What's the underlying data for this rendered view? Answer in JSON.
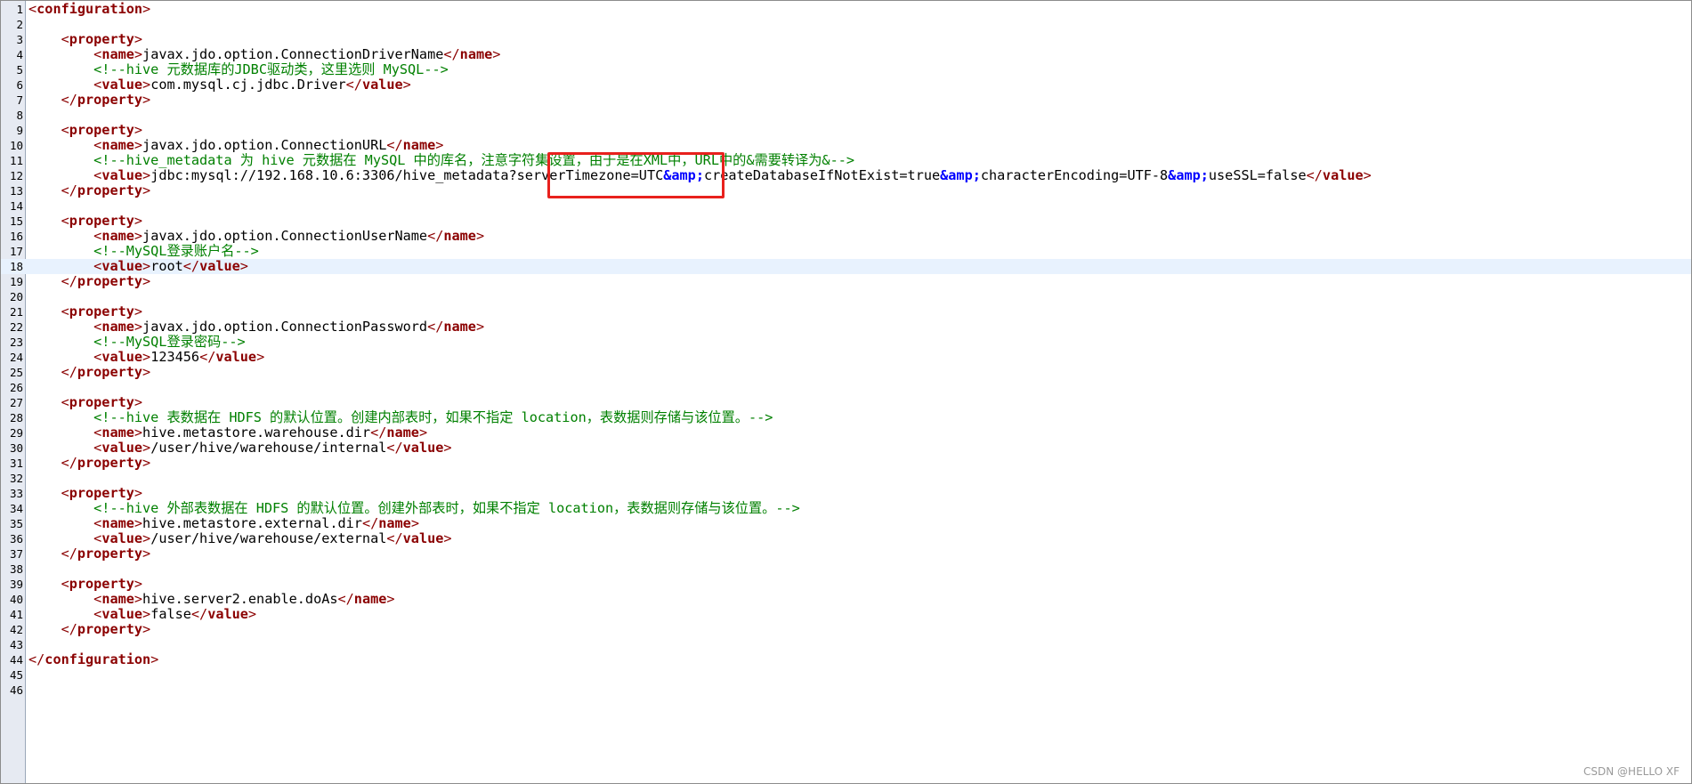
{
  "editor": {
    "current_line": 18,
    "lines": [
      {
        "n": "1",
        "t": [
          [
            "br",
            "<"
          ],
          [
            "tag",
            "configuration"
          ],
          [
            "br",
            ">"
          ]
        ]
      },
      {
        "n": "2",
        "t": []
      },
      {
        "n": "3",
        "t": [
          [
            "txt",
            "    "
          ],
          [
            "br",
            "<"
          ],
          [
            "tag",
            "property"
          ],
          [
            "br",
            ">"
          ]
        ]
      },
      {
        "n": "4",
        "t": [
          [
            "txt",
            "        "
          ],
          [
            "br",
            "<"
          ],
          [
            "tag",
            "name"
          ],
          [
            "br",
            ">"
          ],
          [
            "txt",
            "javax.jdo.option.ConnectionDriverName"
          ],
          [
            "br",
            "</"
          ],
          [
            "tag",
            "name"
          ],
          [
            "br",
            ">"
          ]
        ]
      },
      {
        "n": "5",
        "t": [
          [
            "txt",
            "        "
          ],
          [
            "com",
            "<!--hive 元数据库的JDBC驱动类，这里选则 MySQL-->"
          ]
        ]
      },
      {
        "n": "6",
        "t": [
          [
            "txt",
            "        "
          ],
          [
            "br",
            "<"
          ],
          [
            "tag",
            "value"
          ],
          [
            "br",
            ">"
          ],
          [
            "txt",
            "com.mysql.cj.jdbc.Driver"
          ],
          [
            "br",
            "</"
          ],
          [
            "tag",
            "value"
          ],
          [
            "br",
            ">"
          ]
        ]
      },
      {
        "n": "7",
        "t": [
          [
            "txt",
            "    "
          ],
          [
            "br",
            "</"
          ],
          [
            "tag",
            "property"
          ],
          [
            "br",
            ">"
          ]
        ]
      },
      {
        "n": "8",
        "t": []
      },
      {
        "n": "9",
        "t": [
          [
            "txt",
            "    "
          ],
          [
            "br",
            "<"
          ],
          [
            "tag",
            "property"
          ],
          [
            "br",
            ">"
          ]
        ]
      },
      {
        "n": "10",
        "t": [
          [
            "txt",
            "        "
          ],
          [
            "br",
            "<"
          ],
          [
            "tag",
            "name"
          ],
          [
            "br",
            ">"
          ],
          [
            "txt",
            "javax.jdo.option.ConnectionURL"
          ],
          [
            "br",
            "</"
          ],
          [
            "tag",
            "name"
          ],
          [
            "br",
            ">"
          ]
        ]
      },
      {
        "n": "11",
        "t": [
          [
            "txt",
            "        "
          ],
          [
            "com",
            "<!--hive_metadata 为 hive 元数据在 MySQL 中的库名，注意字符集设置，由于是在XML中，URL中的&需要转译为&-->"
          ]
        ]
      },
      {
        "n": "12",
        "t": [
          [
            "txt",
            "        "
          ],
          [
            "br",
            "<"
          ],
          [
            "tag",
            "value"
          ],
          [
            "br",
            ">"
          ],
          [
            "txt",
            "jdbc:mysql://192.168.10.6:3306/hive_metadata?serverTimezone=UTC"
          ],
          [
            "ent",
            "&amp;"
          ],
          [
            "txt",
            "createDatabaseIfNotExist=true"
          ],
          [
            "ent",
            "&amp;"
          ],
          [
            "txt",
            "characterEncoding=UTF-8"
          ],
          [
            "ent",
            "&amp;"
          ],
          [
            "txt",
            "useSSL=false"
          ],
          [
            "br",
            "</"
          ],
          [
            "tag",
            "value"
          ],
          [
            "br",
            ">"
          ]
        ]
      },
      {
        "n": "13",
        "t": [
          [
            "txt",
            "    "
          ],
          [
            "br",
            "</"
          ],
          [
            "tag",
            "property"
          ],
          [
            "br",
            ">"
          ]
        ]
      },
      {
        "n": "14",
        "t": []
      },
      {
        "n": "15",
        "t": [
          [
            "txt",
            "    "
          ],
          [
            "br",
            "<"
          ],
          [
            "tag",
            "property"
          ],
          [
            "br",
            ">"
          ]
        ]
      },
      {
        "n": "16",
        "t": [
          [
            "txt",
            "        "
          ],
          [
            "br",
            "<"
          ],
          [
            "tag",
            "name"
          ],
          [
            "br",
            ">"
          ],
          [
            "txt",
            "javax.jdo.option.ConnectionUserName"
          ],
          [
            "br",
            "</"
          ],
          [
            "tag",
            "name"
          ],
          [
            "br",
            ">"
          ]
        ]
      },
      {
        "n": "17",
        "t": [
          [
            "txt",
            "        "
          ],
          [
            "com",
            "<!--MySQL登录账户名-->"
          ]
        ]
      },
      {
        "n": "18",
        "t": [
          [
            "txt",
            "        "
          ],
          [
            "br",
            "<"
          ],
          [
            "tag",
            "value"
          ],
          [
            "br",
            ">"
          ],
          [
            "txt",
            "root"
          ],
          [
            "br",
            "</"
          ],
          [
            "tag",
            "value"
          ],
          [
            "br",
            ">"
          ]
        ]
      },
      {
        "n": "19",
        "t": [
          [
            "txt",
            "    "
          ],
          [
            "br",
            "</"
          ],
          [
            "tag",
            "property"
          ],
          [
            "br",
            ">"
          ]
        ]
      },
      {
        "n": "20",
        "t": []
      },
      {
        "n": "21",
        "t": [
          [
            "txt",
            "    "
          ],
          [
            "br",
            "<"
          ],
          [
            "tag",
            "property"
          ],
          [
            "br",
            ">"
          ]
        ]
      },
      {
        "n": "22",
        "t": [
          [
            "txt",
            "        "
          ],
          [
            "br",
            "<"
          ],
          [
            "tag",
            "name"
          ],
          [
            "br",
            ">"
          ],
          [
            "txt",
            "javax.jdo.option.ConnectionPassword"
          ],
          [
            "br",
            "</"
          ],
          [
            "tag",
            "name"
          ],
          [
            "br",
            ">"
          ]
        ]
      },
      {
        "n": "23",
        "t": [
          [
            "txt",
            "        "
          ],
          [
            "com",
            "<!--MySQL登录密码-->"
          ]
        ]
      },
      {
        "n": "24",
        "t": [
          [
            "txt",
            "        "
          ],
          [
            "br",
            "<"
          ],
          [
            "tag",
            "value"
          ],
          [
            "br",
            ">"
          ],
          [
            "txt",
            "123456"
          ],
          [
            "br",
            "</"
          ],
          [
            "tag",
            "value"
          ],
          [
            "br",
            ">"
          ]
        ]
      },
      {
        "n": "25",
        "t": [
          [
            "txt",
            "    "
          ],
          [
            "br",
            "</"
          ],
          [
            "tag",
            "property"
          ],
          [
            "br",
            ">"
          ]
        ]
      },
      {
        "n": "26",
        "t": []
      },
      {
        "n": "27",
        "t": [
          [
            "txt",
            "    "
          ],
          [
            "br",
            "<"
          ],
          [
            "tag",
            "property"
          ],
          [
            "br",
            ">"
          ]
        ]
      },
      {
        "n": "28",
        "t": [
          [
            "txt",
            "        "
          ],
          [
            "com",
            "<!--hive 表数据在 HDFS 的默认位置。创建内部表时，如果不指定 location，表数据则存储与该位置。-->"
          ]
        ]
      },
      {
        "n": "29",
        "t": [
          [
            "txt",
            "        "
          ],
          [
            "br",
            "<"
          ],
          [
            "tag",
            "name"
          ],
          [
            "br",
            ">"
          ],
          [
            "txt",
            "hive.metastore.warehouse.dir"
          ],
          [
            "br",
            "</"
          ],
          [
            "tag",
            "name"
          ],
          [
            "br",
            ">"
          ]
        ]
      },
      {
        "n": "30",
        "t": [
          [
            "txt",
            "        "
          ],
          [
            "br",
            "<"
          ],
          [
            "tag",
            "value"
          ],
          [
            "br",
            ">"
          ],
          [
            "txt",
            "/user/hive/warehouse/internal"
          ],
          [
            "br",
            "</"
          ],
          [
            "tag",
            "value"
          ],
          [
            "br",
            ">"
          ]
        ]
      },
      {
        "n": "31",
        "t": [
          [
            "txt",
            "    "
          ],
          [
            "br",
            "</"
          ],
          [
            "tag",
            "property"
          ],
          [
            "br",
            ">"
          ]
        ]
      },
      {
        "n": "32",
        "t": []
      },
      {
        "n": "33",
        "t": [
          [
            "txt",
            "    "
          ],
          [
            "br",
            "<"
          ],
          [
            "tag",
            "property"
          ],
          [
            "br",
            ">"
          ]
        ]
      },
      {
        "n": "34",
        "t": [
          [
            "txt",
            "        "
          ],
          [
            "com",
            "<!--hive 外部表数据在 HDFS 的默认位置。创建外部表时，如果不指定 location，表数据则存储与该位置。-->"
          ]
        ]
      },
      {
        "n": "35",
        "t": [
          [
            "txt",
            "        "
          ],
          [
            "br",
            "<"
          ],
          [
            "tag",
            "name"
          ],
          [
            "br",
            ">"
          ],
          [
            "txt",
            "hive.metastore.external.dir"
          ],
          [
            "br",
            "</"
          ],
          [
            "tag",
            "name"
          ],
          [
            "br",
            ">"
          ]
        ]
      },
      {
        "n": "36",
        "t": [
          [
            "txt",
            "        "
          ],
          [
            "br",
            "<"
          ],
          [
            "tag",
            "value"
          ],
          [
            "br",
            ">"
          ],
          [
            "txt",
            "/user/hive/warehouse/external"
          ],
          [
            "br",
            "</"
          ],
          [
            "tag",
            "value"
          ],
          [
            "br",
            ">"
          ]
        ]
      },
      {
        "n": "37",
        "t": [
          [
            "txt",
            "    "
          ],
          [
            "br",
            "</"
          ],
          [
            "tag",
            "property"
          ],
          [
            "br",
            ">"
          ]
        ]
      },
      {
        "n": "38",
        "t": []
      },
      {
        "n": "39",
        "t": [
          [
            "txt",
            "    "
          ],
          [
            "br",
            "<"
          ],
          [
            "tag",
            "property"
          ],
          [
            "br",
            ">"
          ]
        ]
      },
      {
        "n": "40",
        "t": [
          [
            "txt",
            "        "
          ],
          [
            "br",
            "<"
          ],
          [
            "tag",
            "name"
          ],
          [
            "br",
            ">"
          ],
          [
            "txt",
            "hive.server2.enable.doAs"
          ],
          [
            "br",
            "</"
          ],
          [
            "tag",
            "name"
          ],
          [
            "br",
            ">"
          ]
        ]
      },
      {
        "n": "41",
        "t": [
          [
            "txt",
            "        "
          ],
          [
            "br",
            "<"
          ],
          [
            "tag",
            "value"
          ],
          [
            "br",
            ">"
          ],
          [
            "txt",
            "false"
          ],
          [
            "br",
            "</"
          ],
          [
            "tag",
            "value"
          ],
          [
            "br",
            ">"
          ]
        ]
      },
      {
        "n": "42",
        "t": [
          [
            "txt",
            "    "
          ],
          [
            "br",
            "</"
          ],
          [
            "tag",
            "property"
          ],
          [
            "br",
            ">"
          ]
        ]
      },
      {
        "n": "43",
        "t": []
      },
      {
        "n": "44",
        "t": [
          [
            "br",
            "</"
          ],
          [
            "tag",
            "configuration"
          ],
          [
            "br",
            ">"
          ]
        ]
      },
      {
        "n": "45",
        "t": []
      },
      {
        "n": "46",
        "t": []
      }
    ]
  },
  "colors": {
    "tag": "#8b0000",
    "comment": "#008000",
    "entity": "#0000ff",
    "highlight_box": "#e8211d",
    "current_line_bg": "#e8f2fe",
    "gutter_bg": "#e6eaf2"
  },
  "watermark": "CSDN @HELLO XF"
}
